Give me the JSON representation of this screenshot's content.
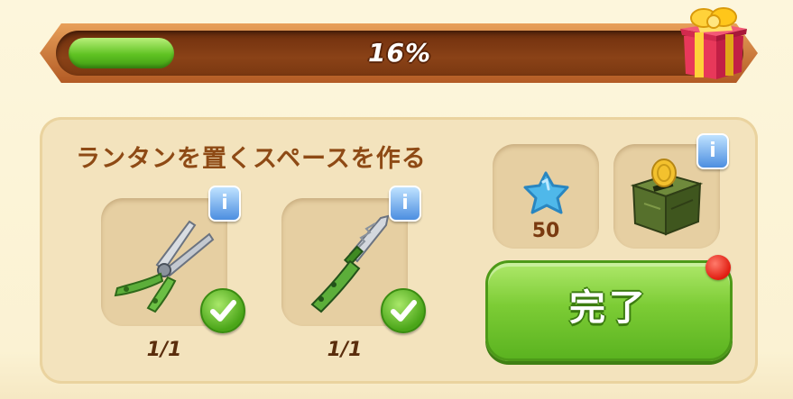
{
  "progress": {
    "percent_label": "16%",
    "fraction": 0.16
  },
  "quest": {
    "title": "ランタンを置くスペースを作る",
    "requirements": [
      {
        "item": "pruning-shears",
        "count": "1/1",
        "completed": true
      },
      {
        "item": "garden-knife",
        "count": "1/1",
        "completed": true
      }
    ]
  },
  "rewards": [
    {
      "item": "blue-star",
      "amount": "50"
    },
    {
      "item": "coin-crate",
      "amount": ""
    }
  ],
  "info_label": "i",
  "done_button": {
    "label": "完了"
  },
  "colors": {
    "accent_green": "#7ccc35",
    "brown_text": "#8e4a15",
    "progress_track": "#8a4217",
    "info_blue": "#4c8ee0"
  }
}
